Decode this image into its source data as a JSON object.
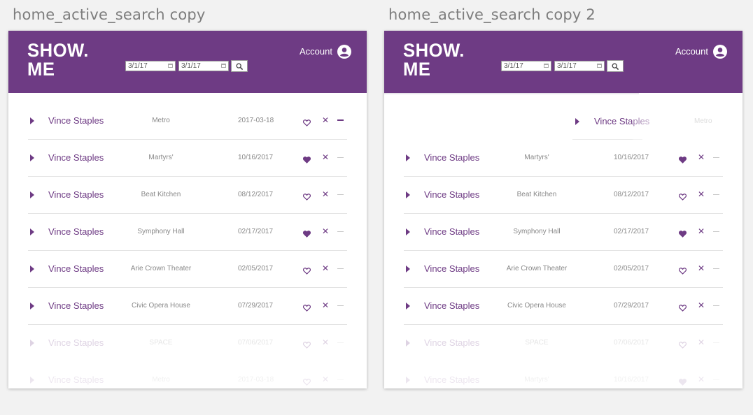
{
  "artboards": [
    {
      "title": "home_active_search copy"
    },
    {
      "title": "home_active_search copy 2"
    }
  ],
  "app": {
    "logo_line1": "SHOW.",
    "logo_line2": "ME",
    "date_from": "3/1/17",
    "date_to": "3/1/17",
    "account_label": "Account",
    "accent_color": "#6e3b84"
  },
  "rows_a": [
    {
      "artist": "Vince Staples",
      "venue": "Metro",
      "date": "2017-03-18",
      "liked": false
    },
    {
      "artist": "Vince Staples",
      "venue": "Martyrs'",
      "date": "10/16/2017",
      "liked": true
    },
    {
      "artist": "Vince Staples",
      "venue": "Beat Kitchen",
      "date": "08/12/2017",
      "liked": false
    },
    {
      "artist": "Vince Staples",
      "venue": "Symphony Hall",
      "date": "02/17/2017",
      "liked": true
    },
    {
      "artist": "Vince Staples",
      "venue": "Arie Crown Theater",
      "date": "02/05/2017",
      "liked": false
    },
    {
      "artist": "Vince Staples",
      "venue": "Civic Opera House",
      "date": "07/29/2017",
      "liked": false
    },
    {
      "artist": "Vince Staples",
      "venue": "SPACE",
      "date": "07/06/2017",
      "liked": false
    }
  ],
  "rows_b": [
    {
      "artist": "Vince Staples",
      "venue": "Martyrs'",
      "date": "10/16/2017",
      "liked": true
    },
    {
      "artist": "Vince Staples",
      "venue": "Beat Kitchen",
      "date": "08/12/2017",
      "liked": false
    },
    {
      "artist": "Vince Staples",
      "venue": "Symphony Hall",
      "date": "02/17/2017",
      "liked": true
    },
    {
      "artist": "Vince Staples",
      "venue": "Arie Crown Theater",
      "date": "02/05/2017",
      "liked": false
    },
    {
      "artist": "Vince Staples",
      "venue": "Civic Opera House",
      "date": "07/29/2017",
      "liked": false
    },
    {
      "artist": "Vince Staples",
      "venue": "SPACE",
      "date": "07/06/2017",
      "liked": false
    }
  ],
  "dragged": {
    "artist": "Vince Staples",
    "venue": "Metro"
  },
  "icons": {
    "play": "play-icon",
    "heart": "heart-icon",
    "remove": "close-icon",
    "collapse": "minus-icon",
    "account": "account-circle-icon",
    "search": "search-icon",
    "calendar": "calendar-icon"
  }
}
